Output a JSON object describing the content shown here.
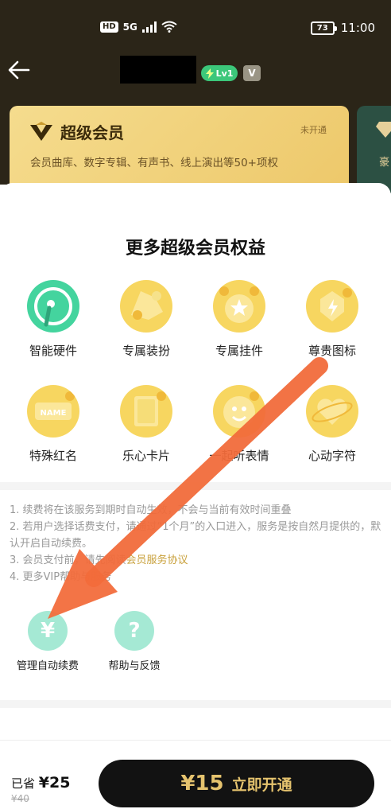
{
  "status_bar": {
    "hd": "HD",
    "network": "5G",
    "battery": "73",
    "time": "11:00"
  },
  "header": {
    "level_badge": "Lv1",
    "v_badge": "V"
  },
  "membership_card": {
    "title": "超级会员",
    "status": "未开通",
    "description": "会员曲库、数字专辑、有声书、线上演出等50+项权"
  },
  "membership_card_2": {
    "label_partial": "豪"
  },
  "perks_section": {
    "title": "更多超级会员权益",
    "items": [
      {
        "label": "智能硬件",
        "icon": "smart-hardware-icon"
      },
      {
        "label": "专属装扮",
        "icon": "exclusive-outfit-icon"
      },
      {
        "label": "专属挂件",
        "icon": "exclusive-pendant-icon"
      },
      {
        "label": "尊贵图标",
        "icon": "noble-badge-icon"
      },
      {
        "label": "特殊红名",
        "icon": "special-red-name-icon"
      },
      {
        "label": "乐心卡片",
        "icon": "music-card-icon"
      },
      {
        "label": "一起听表情",
        "icon": "listen-together-emoji-icon"
      },
      {
        "label": "心动字符",
        "icon": "heart-character-icon"
      }
    ]
  },
  "notes": {
    "line1": "1. 续费将在该服务到期时自动生效，不会与当前有效时间重叠",
    "line2": "2. 若用户选择话费支付，请通过“1个月”的入口进入，服务是按自然月提供的，默认开启自动续费。",
    "line3_prefix": "3. 会员支付前，请先阅读",
    "line3_link": "会员服务协议",
    "line4": "4. 更多VIP帮助与服务"
  },
  "actions": {
    "manage_renewal": {
      "label": "管理自动续费",
      "glyph": "¥"
    },
    "help_feedback": {
      "label": "帮助与反馈",
      "glyph": "?"
    }
  },
  "purchase": {
    "save_prefix": "已省",
    "save_amount": "¥25",
    "original_price": "¥40",
    "price": "¥15",
    "button_label": "立即开通"
  },
  "colors": {
    "header_bg": "#2b2518",
    "card_gold": "#f1d27c",
    "perk_gold": "#f7d660",
    "teal": "#3fcf9b",
    "action_mint": "#a5e9d4",
    "arrow_orange": "#f26b3a",
    "button_black": "#121212",
    "button_text_gold": "#e5c36e"
  }
}
